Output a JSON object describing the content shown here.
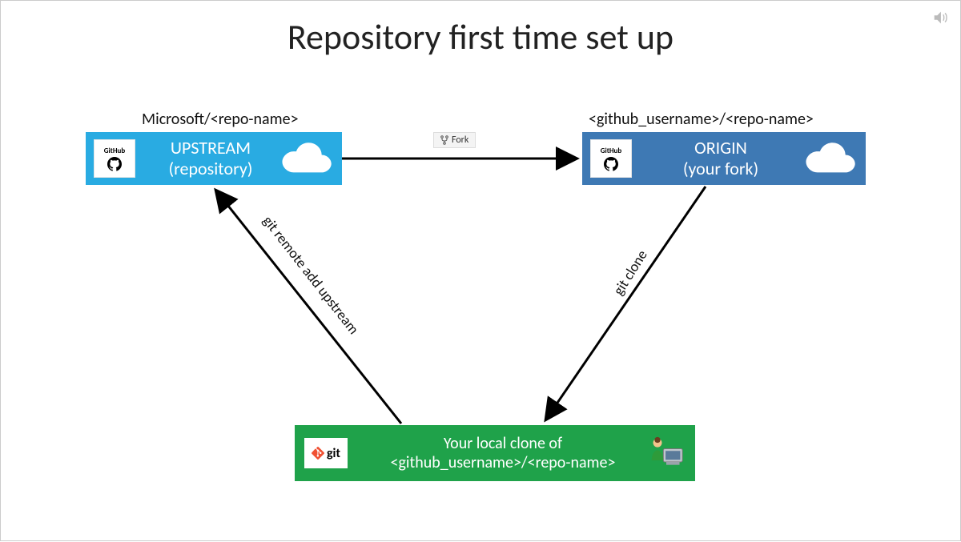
{
  "title": "Repository first time set up",
  "upstream": {
    "path_label": "Microsoft/<repo-name>",
    "line1": "UPSTREAM",
    "line2": "(repository)",
    "badge": "GitHub"
  },
  "origin": {
    "path_label": "<github_username>/<repo-name>",
    "line1": "ORIGIN",
    "line2": "(your fork)",
    "badge": "GitHub"
  },
  "local": {
    "line1": "Your local clone of",
    "line2": "<github_username>/<repo-name>",
    "badge": "git"
  },
  "edges": {
    "fork": "Fork",
    "clone": "git clone",
    "remote_add": "git remote add upstream"
  },
  "colors": {
    "upstream": "#29abe2",
    "origin": "#3e79b4",
    "local": "#1fa24a"
  }
}
